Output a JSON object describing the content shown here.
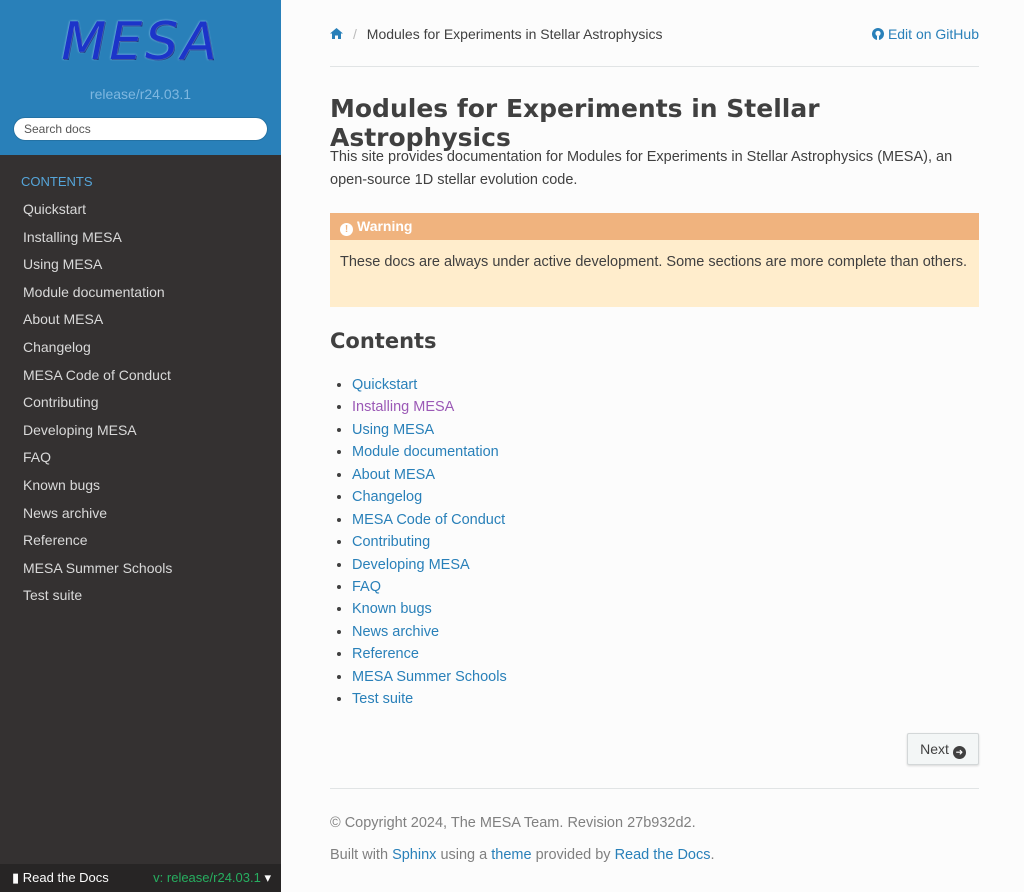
{
  "sidebar": {
    "logo": "MESA",
    "version": "release/r24.03.1",
    "search_placeholder": "Search docs",
    "caption": "Contents",
    "items": [
      "Quickstart",
      "Installing MESA",
      "Using MESA",
      "Module documentation",
      "About MESA",
      "Changelog",
      "MESA Code of Conduct",
      "Contributing",
      "Developing MESA",
      "FAQ",
      "Known bugs",
      "News archive",
      "Reference",
      "MESA Summer Schools",
      "Test suite"
    ]
  },
  "rtd": {
    "label": "Read the Docs",
    "version": "v: release/r24.03.1"
  },
  "breadcrumb": {
    "current": "Modules for Experiments in Stellar Astrophysics",
    "edit": "Edit on GitHub"
  },
  "main": {
    "title": "Modules for Experiments in Stellar Astrophysics",
    "intro": "This site provides documentation for Modules for Experiments in Stellar Astrophysics (MESA), an open-source 1D stellar evolution code.",
    "warning_title": "Warning",
    "warning_body": "These docs are always under active development. Some sections are more complete than others.",
    "contents_heading": "Contents",
    "toc": [
      "Quickstart",
      "Installing MESA",
      "Using MESA",
      "Module documentation",
      "About MESA",
      "Changelog",
      "MESA Code of Conduct",
      "Contributing",
      "Developing MESA",
      "FAQ",
      "Known bugs",
      "News archive",
      "Reference",
      "MESA Summer Schools",
      "Test suite"
    ],
    "next_label": "Next"
  },
  "footer": {
    "copyright": "© Copyright 2024, The MESA Team. Revision 27b932d2.",
    "built_prefix": "Built with",
    "sphinx": "Sphinx",
    "using_a": "using a",
    "theme": "theme",
    "provided_by": "provided by",
    "rtd": "Read the Docs",
    "period": "."
  },
  "colors": {
    "accent": "#2980b9",
    "sidebar_bg": "#343131",
    "warning_bg": "#ffedcc",
    "warning_title_bg": "#f0b37e",
    "visited_link": "#9b59b6"
  }
}
